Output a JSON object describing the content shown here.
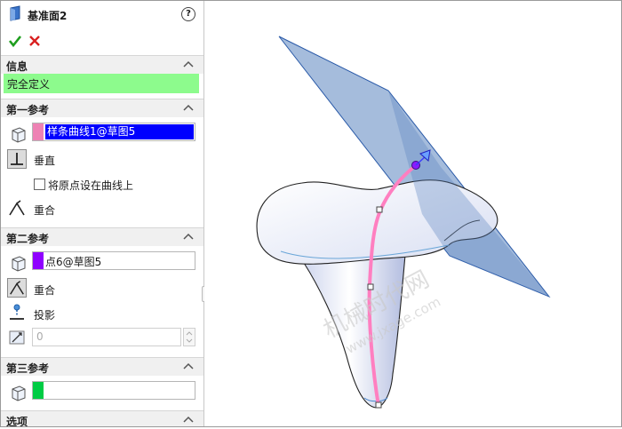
{
  "header": {
    "title": "基准面2",
    "help": "?"
  },
  "actions": {
    "ok_icon": "check-icon",
    "cancel_icon": "x-icon"
  },
  "info": {
    "section_label": "信息",
    "status_text": "完全定义",
    "status_color": "#8dfb8d"
  },
  "ref1": {
    "section_label": "第一参考",
    "field_value": "样条曲线1@草图5",
    "swatch_color": "#ee82b4",
    "option_perpendicular": "垂直",
    "option_origin_checkbox": "将原点设在曲线上",
    "option_coincident": "重合"
  },
  "ref2": {
    "section_label": "第二参考",
    "field_value": "点6@草图5",
    "swatch_color": "#8f00ff",
    "option_coincident": "重合",
    "option_projection": "投影",
    "distance_value": "0"
  },
  "ref3": {
    "section_label": "第三参考",
    "swatch_color": "#00cc44"
  },
  "options": {
    "section_label": "选项"
  },
  "watermark": {
    "line1": "机械时代网",
    "line2": "www.jxage.com"
  },
  "colors": {
    "plane_fill": "#5b85c0",
    "curve": "#ff7fc0",
    "point": "#8a1aff"
  }
}
